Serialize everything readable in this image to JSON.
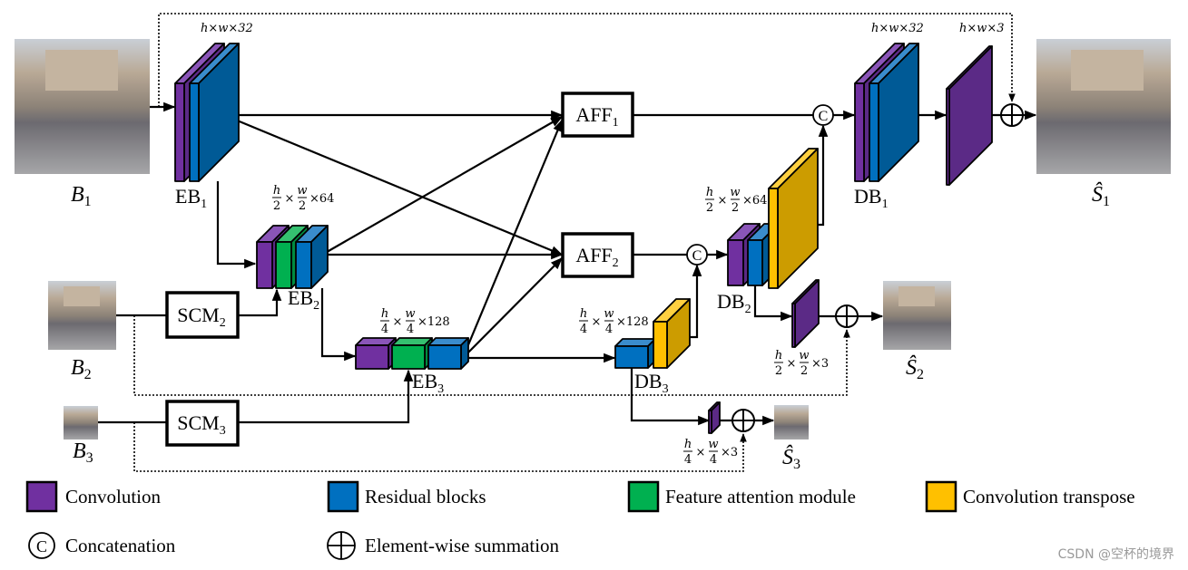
{
  "colors": {
    "convolution": "#7030a0",
    "residual": "#0070c0",
    "attention": "#00b050",
    "transpose": "#ffc000"
  },
  "inputs": {
    "b1": {
      "main": "B",
      "sub": "1"
    },
    "b2": {
      "main": "B",
      "sub": "2"
    },
    "b3": {
      "main": "B",
      "sub": "3"
    }
  },
  "outputs": {
    "s1": {
      "main": "Ŝ",
      "sub": "1"
    },
    "s2": {
      "main": "Ŝ",
      "sub": "2"
    },
    "s3": {
      "main": "Ŝ",
      "sub": "3"
    }
  },
  "blocks": {
    "eb1": {
      "main": "EB",
      "sub": "1"
    },
    "eb2": {
      "main": "EB",
      "sub": "2"
    },
    "eb3": {
      "main": "EB",
      "sub": "3"
    },
    "db1": {
      "main": "DB",
      "sub": "1"
    },
    "db2": {
      "main": "DB",
      "sub": "2"
    },
    "db3": {
      "main": "DB",
      "sub": "3"
    },
    "aff1": {
      "main": "AFF",
      "sub": "1"
    },
    "aff2": {
      "main": "AFF",
      "sub": "2"
    },
    "scm2": {
      "main": "SCM",
      "sub": "2"
    },
    "scm3": {
      "main": "SCM",
      "sub": "3"
    },
    "concat_symbol": "C"
  },
  "dims": {
    "eb1": "h×w×32",
    "db1": "h×w×32",
    "out1": "h×w×3",
    "eb2": {
      "n1": "h",
      "d1": "2",
      "n2": "w",
      "d2": "2",
      "rest": "×64"
    },
    "db2": {
      "n1": "h",
      "d1": "2",
      "n2": "w",
      "d2": "2",
      "rest": "×64"
    },
    "eb3": {
      "n1": "h",
      "d1": "4",
      "n2": "w",
      "d2": "4",
      "rest": "×128"
    },
    "db3": {
      "n1": "h",
      "d1": "4",
      "n2": "w",
      "d2": "4",
      "rest": "×128"
    },
    "out2": {
      "n1": "h",
      "d1": "2",
      "n2": "w",
      "d2": "2",
      "rest": "×3"
    },
    "out3": {
      "n1": "h",
      "d1": "4",
      "n2": "w",
      "d2": "4",
      "rest": "×3"
    }
  },
  "legend": {
    "convolution": "Convolution",
    "residual": "Residual blocks",
    "attention": "Feature attention module",
    "transpose": "Convolution transpose",
    "concatenation": "Concatenation",
    "summation": "Element-wise summation"
  },
  "watermark": "CSDN @空杯的境界"
}
